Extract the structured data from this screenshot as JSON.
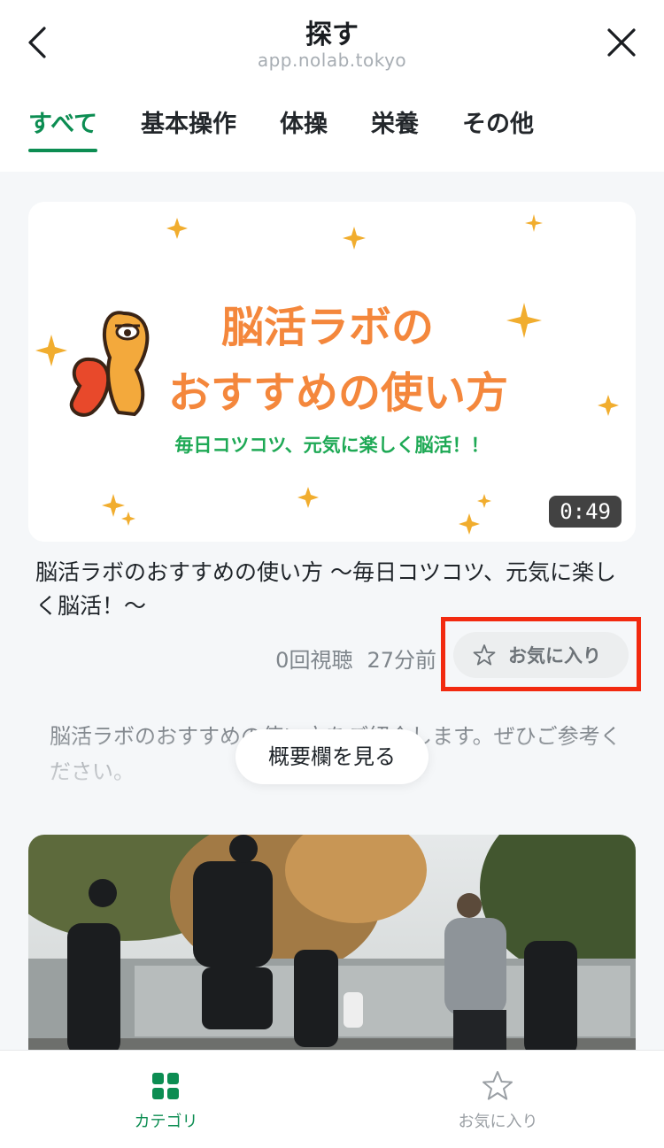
{
  "header": {
    "title": "探す",
    "subtitle": "app.nolab.tokyo"
  },
  "tabs": [
    {
      "label": "すべて",
      "active": true
    },
    {
      "label": "基本操作",
      "active": false
    },
    {
      "label": "体操",
      "active": false
    },
    {
      "label": "栄養",
      "active": false
    },
    {
      "label": "その他",
      "active": false
    }
  ],
  "video": {
    "thumbnail": {
      "heading_line1": "脳活ラボの",
      "heading_line2": "おすすめの使い方",
      "tagline": "毎日コツコツ、元気に楽しく脳活！！"
    },
    "duration": "0:49",
    "title": "脳活ラボのおすすめの使い方 〜毎日コツコツ、元気に楽しく脳活！〜",
    "views": "0回視聴",
    "posted": "27分前",
    "favorite_label": "お気に入り",
    "description": "脳活ラボのおすすめの使い方をご紹介します。ぜひご参考ください。",
    "see_more_label": "概要欄を見る"
  },
  "bottom_nav": {
    "items": [
      {
        "label": "カテゴリ",
        "icon": "grid-icon",
        "active": true
      },
      {
        "label": "お気に入り",
        "icon": "star-icon",
        "active": false
      }
    ]
  },
  "colors": {
    "accent": "#0c8d52",
    "highlight": "#f22a10",
    "thumb_orange": "#f4873c"
  }
}
